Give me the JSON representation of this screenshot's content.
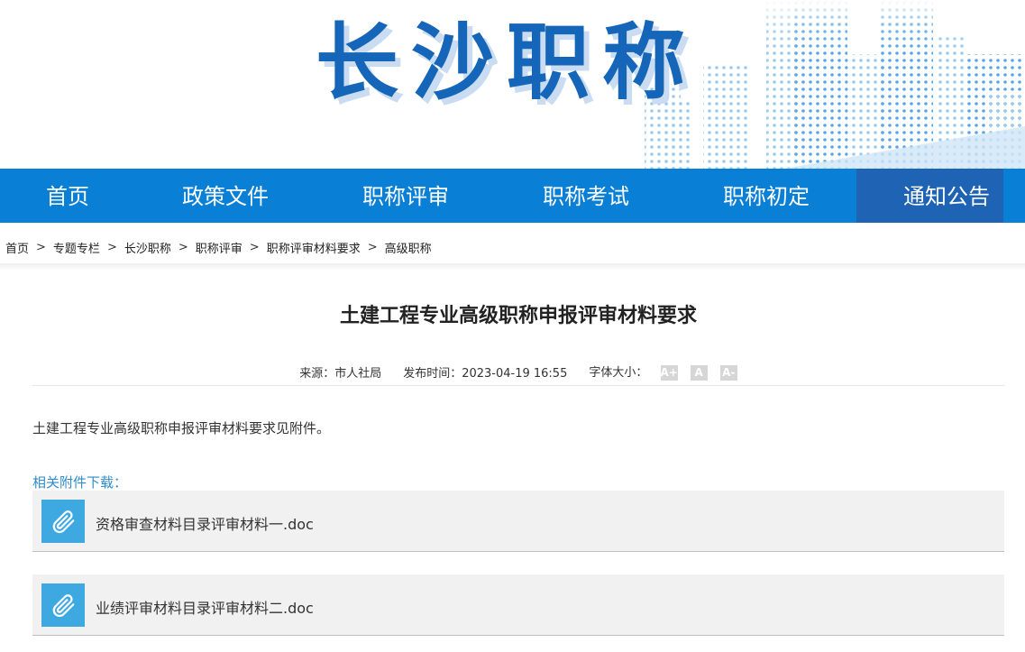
{
  "banner": {
    "title": "长沙职称"
  },
  "nav": {
    "items": [
      {
        "label": "首页"
      },
      {
        "label": "政策文件"
      },
      {
        "label": "职称评审"
      },
      {
        "label": "职称考试"
      },
      {
        "label": "职称初定"
      },
      {
        "label": "通知公告"
      }
    ],
    "active_index": 5
  },
  "breadcrumb": {
    "items": [
      "首页",
      "专题专栏",
      "长沙职称",
      "职称评审",
      "职称评审材料要求",
      "高级职称"
    ],
    "separator": ">"
  },
  "article": {
    "title": "土建工程专业高级职称申报评审材料要求",
    "source": "来源：市人社局",
    "published": "发布时间：2023-04-19 16:55",
    "font_size_label": "字体大小：",
    "font_buttons": [
      "A+",
      "A",
      "A-"
    ],
    "body": "土建工程专业高级职称申报评审材料要求见附件。",
    "attachments_heading": "相关附件下载：",
    "attachments": [
      {
        "name": "资格审查材料目录评审材料一.doc",
        "icon": "paperclip-icon"
      },
      {
        "name": "业绩评审材料目录评审材料二.doc",
        "icon": "paperclip-icon"
      }
    ]
  },
  "colors": {
    "nav_bg": "#0a7fd6",
    "nav_active": "#1f63b4",
    "title_blue": "#1565b8",
    "attach_icon_bg": "#3da9e0",
    "link_blue": "#2e8bc8"
  }
}
